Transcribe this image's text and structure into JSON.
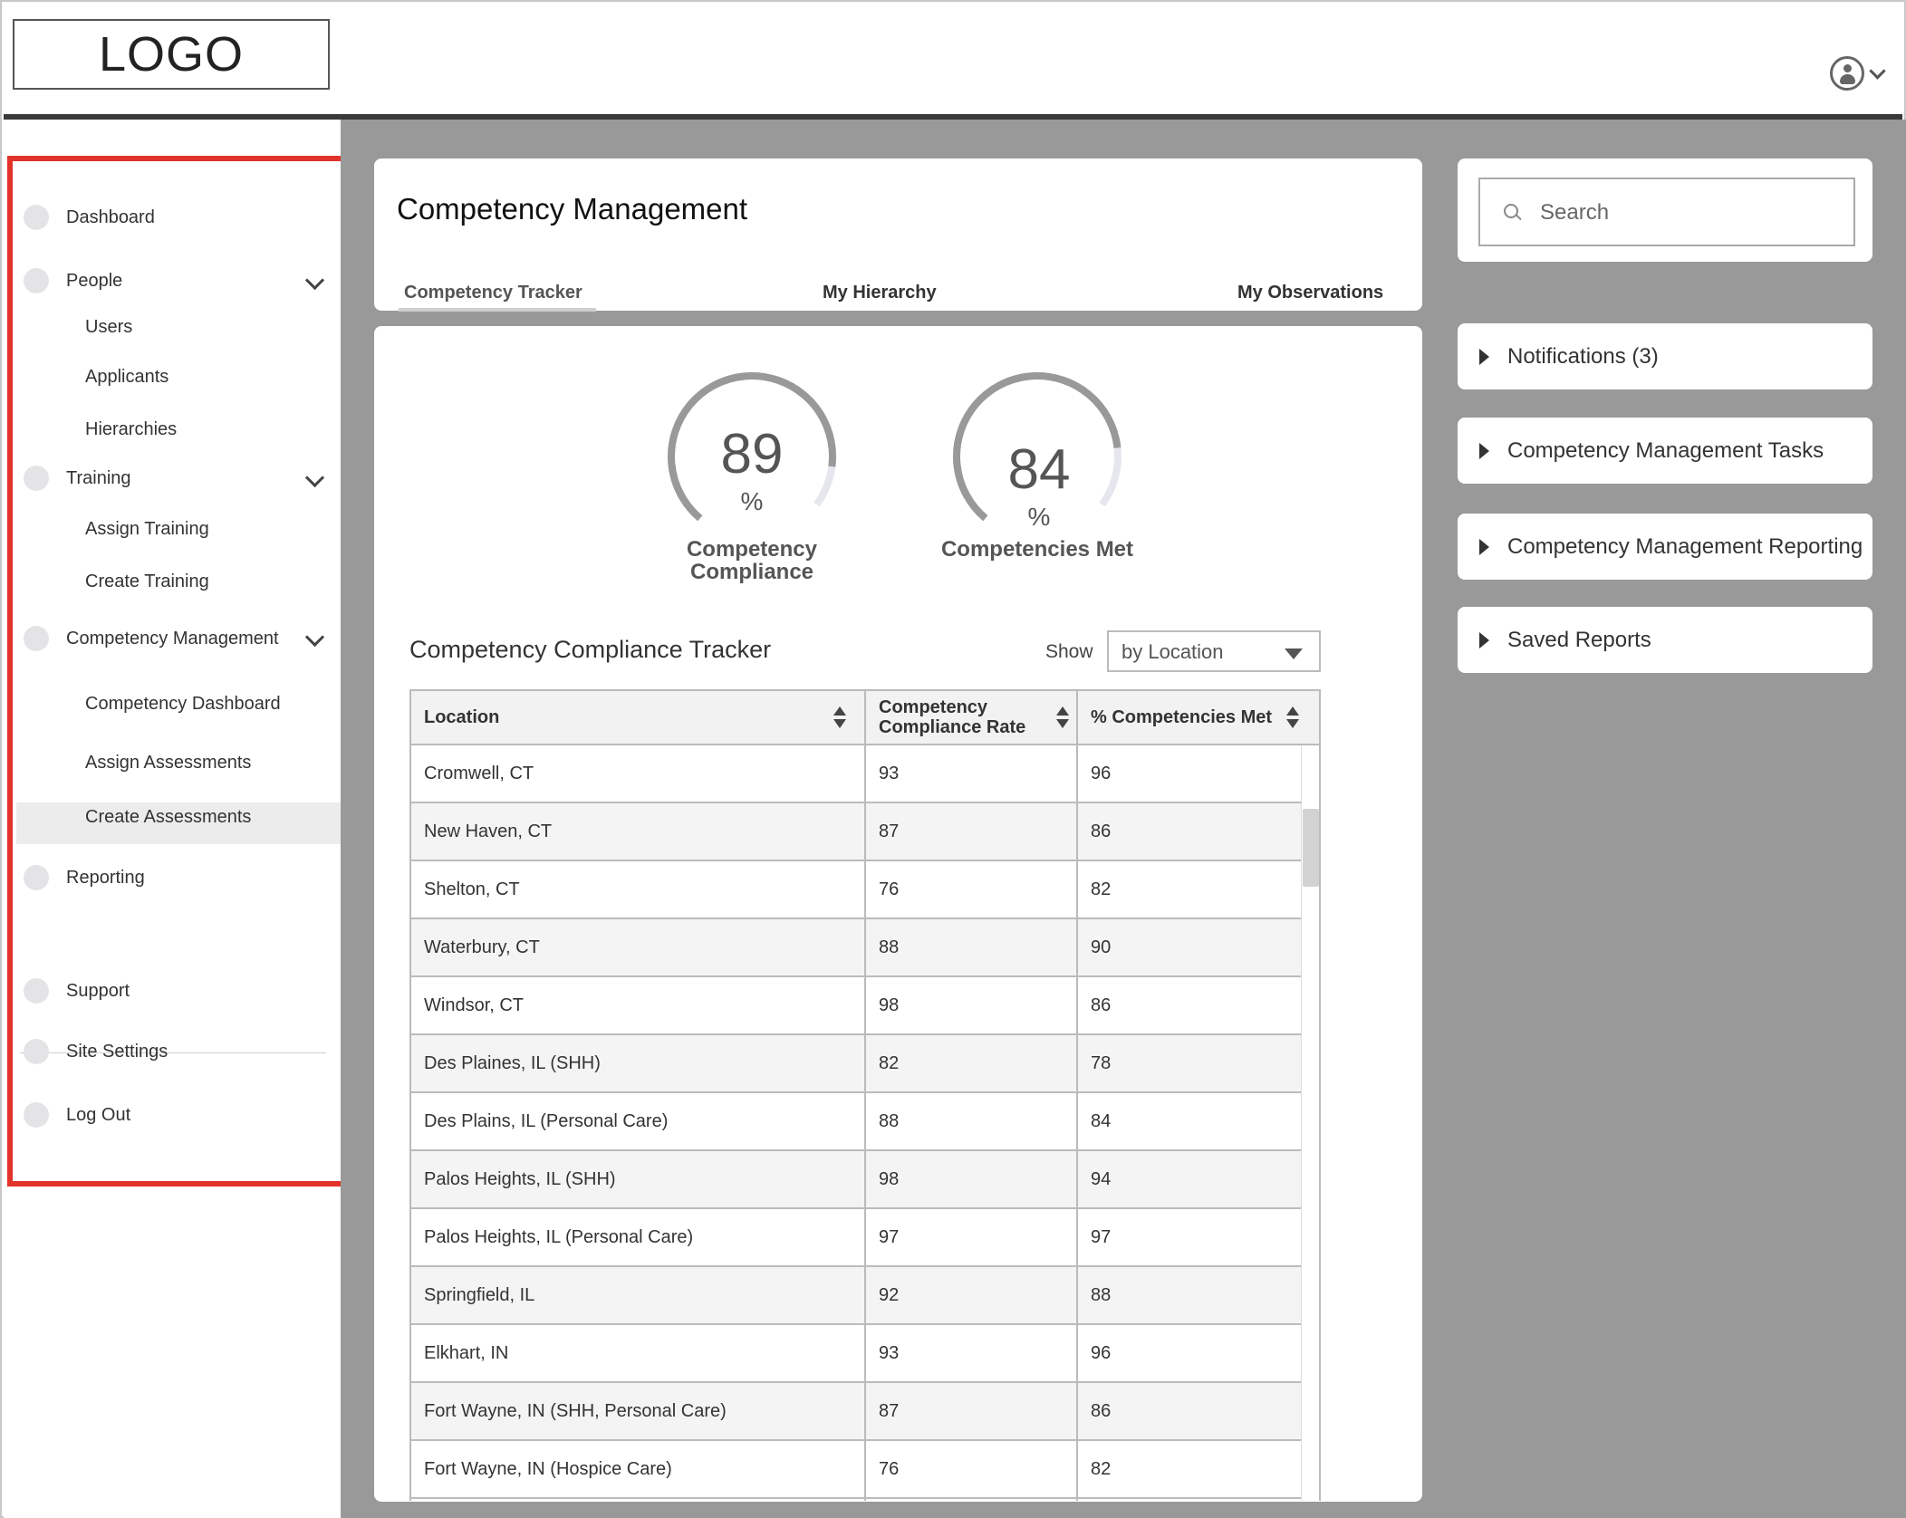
{
  "header": {
    "logo_text": "LOGO"
  },
  "sidebar": {
    "items": [
      {
        "label": "Dashboard"
      },
      {
        "label": "People",
        "children": [
          "Users",
          "Applicants",
          "Hierarchies"
        ]
      },
      {
        "label": "Training",
        "children": [
          "Assign Training",
          "Create Training"
        ]
      },
      {
        "label": "Competency Management",
        "children": [
          "Competency Dashboard",
          "Assign Assessments",
          "Create Assessments"
        ],
        "active_child": "Competency Dashboard"
      },
      {
        "label": "Reporting"
      }
    ],
    "footer_items": [
      {
        "label": "Support"
      },
      {
        "label": "Site Settings"
      },
      {
        "label": "Log Out"
      }
    ]
  },
  "main": {
    "title": "Competency Management",
    "tabs": [
      {
        "label": "Competency Tracker",
        "active": true
      },
      {
        "label": "My Hierarchy"
      },
      {
        "label": "My Observations"
      }
    ],
    "gauges": [
      {
        "value": "89",
        "unit": "%",
        "label_line1": "Competency",
        "label_line2": "Compliance",
        "fraction": 0.89
      },
      {
        "value": "84",
        "unit": "%",
        "label": "Competencies Met",
        "fraction": 0.84
      }
    ],
    "tracker": {
      "title": "Competency Compliance Tracker",
      "show_label": "Show",
      "show_value": "by Location",
      "columns": {
        "location": "Location",
        "rate_line1": "Competency",
        "rate_line2": "Compliance Rate",
        "met": "% Competencies Met"
      },
      "rows": [
        [
          "Cromwell, CT",
          "93",
          "96"
        ],
        [
          "New Haven, CT",
          "87",
          "86"
        ],
        [
          "Shelton, CT",
          "76",
          "82"
        ],
        [
          "Waterbury, CT",
          "88",
          "90"
        ],
        [
          "Windsor, CT",
          "98",
          "86"
        ],
        [
          "Des Plaines, IL (SHH)",
          "82",
          "78"
        ],
        [
          "Des Plains, IL (Personal Care)",
          "88",
          "84"
        ],
        [
          "Palos Heights, IL (SHH)",
          "98",
          "94"
        ],
        [
          "Palos Heights, IL (Personal Care)",
          "97",
          "97"
        ],
        [
          "Springfield, IL",
          "92",
          "88"
        ],
        [
          "Elkhart, IN",
          "93",
          "96"
        ],
        [
          "Fort Wayne, IN (SHH, Personal Care)",
          "87",
          "86"
        ],
        [
          "Fort Wayne, IN (Hospice Care)",
          "76",
          "82"
        ]
      ]
    }
  },
  "right": {
    "search": {
      "placeholder": "Search"
    },
    "panels": [
      {
        "label": "Notifications (3)"
      },
      {
        "label": "Competency Management Tasks"
      },
      {
        "label": "Competency Management Reporting"
      },
      {
        "label": "Saved Reports"
      }
    ]
  },
  "colors": {
    "accent_red": "#e2332b",
    "content_grey": "#999999",
    "gauge_fill": "#999999",
    "gauge_track": "#e6e6ee"
  }
}
